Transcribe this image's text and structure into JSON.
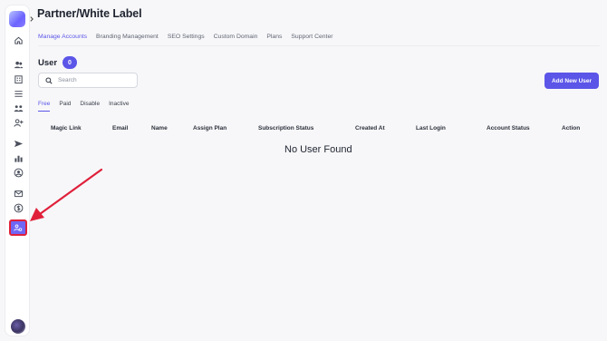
{
  "app": {
    "title": "Partner/White Label"
  },
  "tabs": [
    {
      "label": "Manage Accounts",
      "active": true
    },
    {
      "label": "Branding Management",
      "active": false
    },
    {
      "label": "SEO Settings",
      "active": false
    },
    {
      "label": "Custom Domain",
      "active": false
    },
    {
      "label": "Plans",
      "active": false
    },
    {
      "label": "Support Center",
      "active": false
    }
  ],
  "users": {
    "title": "User",
    "count": "0",
    "search_placeholder": "Search",
    "add_button": "Add New User",
    "filters": [
      "Free",
      "Paid",
      "Disable",
      "Inactive"
    ],
    "columns": [
      "Magic Link",
      "Email",
      "Name",
      "Assign Plan",
      "Subscription Status",
      "Created At",
      "Last Login",
      "Account Status",
      "Action"
    ],
    "empty_message": "No User Found"
  },
  "sidebar": {
    "icons": [
      "home-icon",
      "users-icon",
      "building-icon",
      "list-icon",
      "team-icon",
      "user-add-icon",
      "send-icon",
      "chart-icon",
      "user-circle-icon",
      "mail-icon",
      "dollar-icon",
      "partner-icon"
    ],
    "active": "partner-icon"
  },
  "colors": {
    "accent": "#5b55e8",
    "annotation": "#e0203a"
  }
}
